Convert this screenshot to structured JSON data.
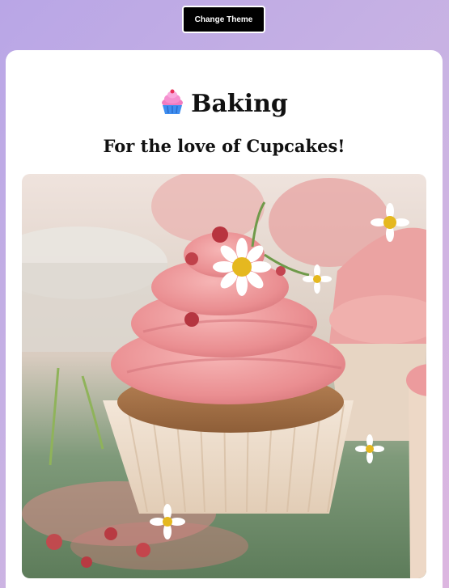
{
  "toolbar": {
    "change_theme_label": "Change Theme"
  },
  "card": {
    "title": "Baking",
    "subtitle": "For the love of Cupcakes!"
  },
  "icons": {
    "title_icon": "cupcake-icon"
  },
  "colors": {
    "button_bg": "#000000",
    "card_bg": "#ffffff",
    "frosting": "#e8868c"
  }
}
